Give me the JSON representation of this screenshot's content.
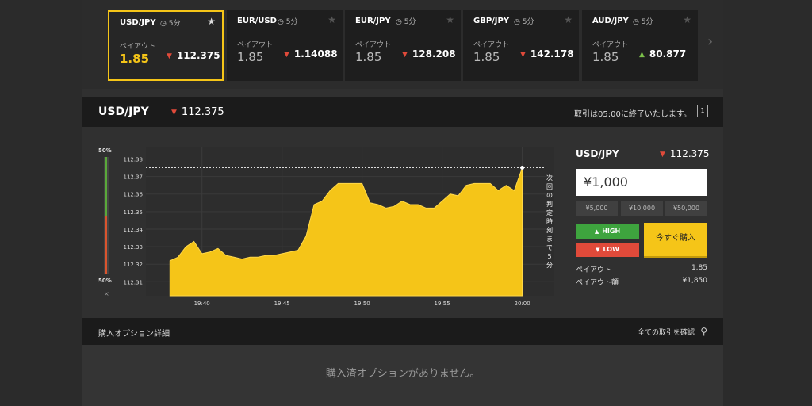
{
  "cards": [
    {
      "pair": "USD/JPY",
      "period": "5分",
      "payout_label": "ペイアウト",
      "payout": "1.85",
      "rate": "112.375",
      "dir": "down",
      "active": true
    },
    {
      "pair": "EUR/USD",
      "period": "5分",
      "payout_label": "ペイアウト",
      "payout": "1.85",
      "rate": "1.14088",
      "dir": "down",
      "active": false
    },
    {
      "pair": "EUR/JPY",
      "period": "5分",
      "payout_label": "ペイアウト",
      "payout": "1.85",
      "rate": "128.208",
      "dir": "down",
      "active": false
    },
    {
      "pair": "GBP/JPY",
      "period": "5分",
      "payout_label": "ペイアウト",
      "payout": "1.85",
      "rate": "142.178",
      "dir": "down",
      "active": false
    },
    {
      "pair": "AUD/JPY",
      "period": "5分",
      "payout_label": "ペイアウト",
      "payout": "1.85",
      "rate": "80.877",
      "dir": "up",
      "active": false
    }
  ],
  "icons": {
    "clock": "clock-icon",
    "star": "star-icon",
    "next": "chevron-right-icon",
    "down": "down-arrow-icon",
    "up": "up-arrow-icon",
    "search": "search-icon",
    "expand": "expand-icon",
    "close": "close-icon"
  },
  "header": {
    "pair": "USD/JPY",
    "rate": "112.375",
    "notice": "取引は05:00に終了いたします。"
  },
  "prob": {
    "top": "50%",
    "bottom": "50%",
    "close": "×"
  },
  "chart_data": {
    "type": "area",
    "title": "",
    "xlabel": "",
    "ylabel": "",
    "x_ticks": [
      "19:40",
      "19:45",
      "19:50",
      "19:55",
      "20:00"
    ],
    "y_ticks": [
      "112.31",
      "112.32",
      "112.33",
      "112.34",
      "112.35",
      "112.36",
      "112.37",
      "112.38"
    ],
    "ylim": [
      112.302,
      112.387
    ],
    "grid": true,
    "color": "#f5c518",
    "current_rate": 112.375,
    "expiry_text": "次回の判定時刻まで5分",
    "x": [
      -2.0,
      -1.5,
      -1.0,
      -0.5,
      0.0,
      0.5,
      1.0,
      1.5,
      2.0,
      2.5,
      3.0,
      3.5,
      4.0,
      4.5,
      5.0,
      5.5,
      6.0,
      6.5,
      7.0,
      7.5,
      8.0,
      8.5,
      9.0,
      9.5,
      10.0,
      10.5,
      11.0,
      11.5,
      12.0,
      12.5,
      13.0,
      13.5,
      14.0,
      14.5,
      15.0,
      15.5,
      16.0,
      16.5,
      17.0,
      17.5,
      18.0,
      18.5,
      19.0,
      19.5,
      20.0
    ],
    "values": [
      112.322,
      112.324,
      112.33,
      112.333,
      112.326,
      112.327,
      112.329,
      112.325,
      112.324,
      112.323,
      112.324,
      112.324,
      112.325,
      112.325,
      112.326,
      112.327,
      112.328,
      112.336,
      112.354,
      112.356,
      112.362,
      112.366,
      112.366,
      112.366,
      112.366,
      112.355,
      112.354,
      112.352,
      112.353,
      112.356,
      112.354,
      112.354,
      112.352,
      112.352,
      112.356,
      112.36,
      112.359,
      112.365,
      112.366,
      112.366,
      112.366,
      112.362,
      112.365,
      112.362,
      112.375
    ]
  },
  "trade": {
    "pair": "USD/JPY",
    "rate": "112.375",
    "amount": "¥1,000",
    "presets": [
      "¥5,000",
      "¥10,000",
      "¥50,000"
    ],
    "high": "HIGH",
    "low": "LOW",
    "buy": "今すぐ購入",
    "payout_label": "ペイアウト",
    "payout": "1.85",
    "payout_amount_label": "ペイアウト額",
    "payout_amount": "¥1,850"
  },
  "options": {
    "title": "購入オプション詳細",
    "all_trades": "全ての取引を確認",
    "empty": "購入済オプションがありません。"
  }
}
